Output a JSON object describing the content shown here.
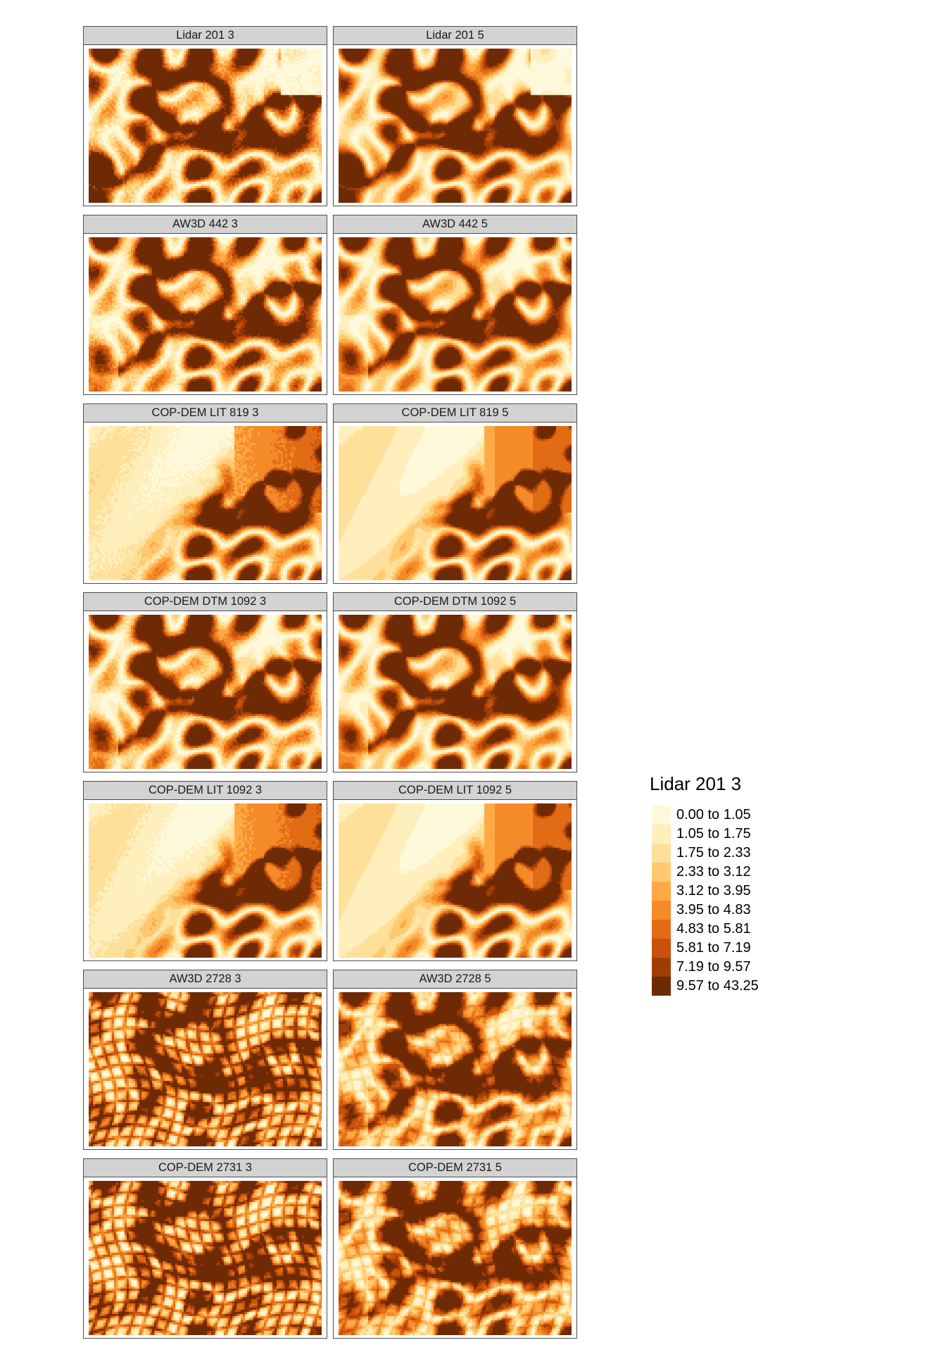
{
  "chart_data": {
    "type": "heatmap",
    "panels": [
      {
        "label": "Lidar 201 3",
        "mode": "lidar",
        "sharp": 0.6,
        "artifact": 0
      },
      {
        "label": "Lidar 201 5",
        "mode": "lidar",
        "sharp": 0.0,
        "artifact": 0
      },
      {
        "label": "AW3D 442 3",
        "mode": "full",
        "sharp": 0.5,
        "artifact": 0
      },
      {
        "label": "AW3D 442 5",
        "mode": "full",
        "sharp": 0.1,
        "artifact": 0
      },
      {
        "label": "COP-DEM LIT 819 3",
        "mode": "lit",
        "sharp": 0.3,
        "artifact": 0
      },
      {
        "label": "COP-DEM LIT 819 5",
        "mode": "lit",
        "sharp": 0.0,
        "artifact": 0
      },
      {
        "label": "COP-DEM DTM 1092 3",
        "mode": "full",
        "sharp": 0.4,
        "artifact": 0
      },
      {
        "label": "COP-DEM DTM 1092 5",
        "mode": "full",
        "sharp": 0.0,
        "artifact": 0
      },
      {
        "label": "COP-DEM LIT 1092 3",
        "mode": "lit",
        "sharp": 0.2,
        "artifact": 0
      },
      {
        "label": "COP-DEM LIT 1092 5",
        "mode": "lit",
        "sharp": 0.0,
        "artifact": 0
      },
      {
        "label": "AW3D 2728 3",
        "mode": "full",
        "sharp": 0.3,
        "artifact": 1.0
      },
      {
        "label": "AW3D 2728 5",
        "mode": "full",
        "sharp": 0.2,
        "artifact": 0.35
      },
      {
        "label": "COP-DEM 2731 3",
        "mode": "full",
        "sharp": 0.3,
        "artifact": 1.0
      },
      {
        "label": "COP-DEM 2731 5",
        "mode": "full",
        "sharp": 0.2,
        "artifact": 0.45
      }
    ],
    "legend": {
      "title": "Lidar 201 3",
      "classes": [
        {
          "label": "0.00 to 1.05",
          "color": "#fff9dc"
        },
        {
          "label": "1.05 to 1.75",
          "color": "#ffefbd"
        },
        {
          "label": "1.75 to 2.33",
          "color": "#fee09a"
        },
        {
          "label": "2.33 to 3.12",
          "color": "#fec96f"
        },
        {
          "label": "3.12 to 3.95",
          "color": "#fdaa46"
        },
        {
          "label": "3.95 to 4.83",
          "color": "#f58a28"
        },
        {
          "label": "4.83 to 5.81",
          "color": "#e26c15"
        },
        {
          "label": "5.81 to 7.19",
          "color": "#c8520b"
        },
        {
          "label": "7.19 to 9.57",
          "color": "#a03d07"
        },
        {
          "label": "9.57 to 43.25",
          "color": "#6e2a05"
        }
      ]
    }
  }
}
